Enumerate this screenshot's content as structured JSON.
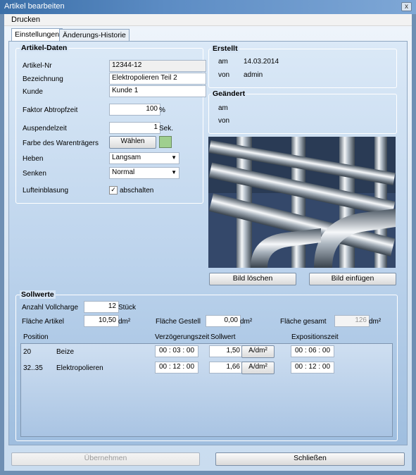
{
  "window": {
    "title": "Artikel bearbeiten",
    "close_glyph": "x"
  },
  "menu": {
    "items": [
      "Drucken"
    ]
  },
  "tabs": [
    {
      "label": "Einstellungen",
      "active": true
    },
    {
      "label": "Änderungs-Historie",
      "active": false
    }
  ],
  "artikel": {
    "legend": "Artikel-Daten",
    "artikel_nr": {
      "label": "Artikel-Nr",
      "value": "12344-12"
    },
    "bezeichnung": {
      "label": "Bezeichnung",
      "value": "Elektropolieren Teil 2"
    },
    "kunde": {
      "label": "Kunde",
      "value": "Kunde 1"
    },
    "faktor": {
      "label": "Faktor Abtropfzeit",
      "value": "100",
      "unit": "%"
    },
    "auspendel": {
      "label": "Auspendelzeit",
      "value": "1",
      "unit": "Sek."
    },
    "farbe": {
      "label": "Farbe des Warenträgers",
      "button": "Wählen",
      "color": "#9fcf8f"
    },
    "heben": {
      "label": "Heben",
      "value": "Langsam"
    },
    "senken": {
      "label": "Senken",
      "value": "Normal"
    },
    "luft": {
      "label": "Lufteinblasung",
      "checkbox_label": "abschalten",
      "checked": true
    }
  },
  "erstellt": {
    "legend": "Erstellt",
    "am_label": "am",
    "am_value": "14.03.2014",
    "von_label": "von",
    "von_value": "admin"
  },
  "geaendert": {
    "legend": "Geändert",
    "am_label": "am",
    "von_label": "von"
  },
  "image_buttons": {
    "delete": "Bild löschen",
    "insert": "Bild einfügen"
  },
  "sollwerte": {
    "legend": "Sollwerte",
    "anzahl": {
      "label": "Anzahl Vollcharge",
      "value": "12",
      "unit": "Stück"
    },
    "flaeche_artikel": {
      "label": "Fläche Artikel",
      "value": "10,50",
      "unit": "dm²"
    },
    "flaeche_gestell": {
      "label": "Fläche Gestell",
      "value": "0,00",
      "unit": "dm²"
    },
    "flaeche_gesamt": {
      "label": "Fläche gesamt",
      "value": "126",
      "unit": "dm²"
    },
    "headers": {
      "position": "Position",
      "verzoegerung": "Verzögerungszeit",
      "sollwert": "Sollwert",
      "exposition": "Expositionszeit"
    },
    "rows": [
      {
        "pos": "20",
        "name": "Beize",
        "verz": "00 : 03 : 00",
        "soll": "1,50",
        "unit": "A/dm²",
        "expo": "00 : 06 : 00"
      },
      {
        "pos": "32..35",
        "name": "Elektropolieren",
        "verz": "00 : 12 : 00",
        "soll": "1,66",
        "unit": "A/dm²",
        "expo": "00 : 12 : 00"
      }
    ]
  },
  "footer": {
    "apply": "Übernehmen",
    "close": "Schließen"
  }
}
